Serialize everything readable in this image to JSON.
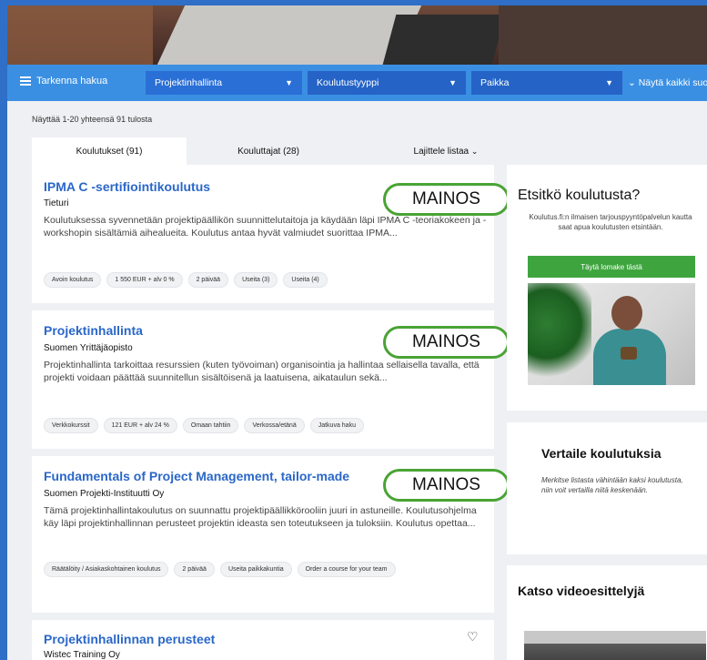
{
  "filterbar": {
    "refine_label": "Tarkenna hakua",
    "select1": "Projektinhallinta",
    "select2": "Koulutustyyppi",
    "select3": "Paikka",
    "show_all": "⌄ Näytä kaikki suo"
  },
  "results": {
    "count_text": "Näyttää 1-20 yhteensä 91 tulosta"
  },
  "tabs": {
    "courses": "Koulutukset (91)",
    "trainers": "Kouluttajat (28)",
    "sort": "Lajittele listaa"
  },
  "ad_label": "MAINOS",
  "cards": [
    {
      "title": "IPMA C -sertifiointikoulutus",
      "provider": "Tieturi",
      "desc": "Koulutuksessa syvennetään projektipäällikön suunnittelutaitoja ja käydään läpi IPMA C -teoriakokeen ja -workshopin sisältämiä aihealueita. Koulutus antaa hyvät valmiudet suorittaa IPMA...",
      "tags": [
        "Avoin koulutus",
        "1 550 EUR + alv 0 %",
        "2 päivää",
        "Useita (3)",
        "Useita (4)"
      ]
    },
    {
      "title": "Projektinhallinta",
      "provider": "Suomen Yrittäjäopisto",
      "desc": "Projektinhallinta tarkoittaa resurssien (kuten työvoiman) organisointia ja hallintaa sellaisella tavalla, että projekti voidaan päättää suunnitellun sisältöisenä ja laatuisena, aikataulun sekä...",
      "tags": [
        "Verkkokurssit",
        "121 EUR + alv 24 %",
        "Omaan tahtiin",
        "Verkossa/etänä",
        "Jatkuva haku"
      ]
    },
    {
      "title": "Fundamentals of Project Management, tailor-made",
      "provider": "Suomen Projekti-Instituutti Oy",
      "desc": "Tämä projektinhallintakoulutus on suunnattu projektipäällikkörooliin juuri in astuneille. Koulutusohjelma käy läpi projektinhallinnan perusteet projektin ideasta sen toteutukseen ja tuloksiin. Koulutus opettaa...",
      "tags": [
        "Räätälöity / Asiakaskohtainen koulutus",
        "2 päivää",
        "Useita paikkakuntia",
        "Order a course for your team"
      ]
    },
    {
      "title": "Projektinhallinnan perusteet",
      "provider": "Wistec Training Oy"
    }
  ],
  "sidebar": {
    "find_title": "Etsitkö koulutusta?",
    "find_text": "Koulutus.fi:n ilmaisen tarjouspyyntöpalvelun kautta saat apua koulutusten etsintään.",
    "find_button": "Täytä lomake tästä",
    "compare_title": "Vertaile koulutuksia",
    "compare_text": "Merkitse listasta vähintään kaksi koulutusta, niin voit vertailla niitä keskenään.",
    "video_title": "Katso videoesittelyjä"
  }
}
